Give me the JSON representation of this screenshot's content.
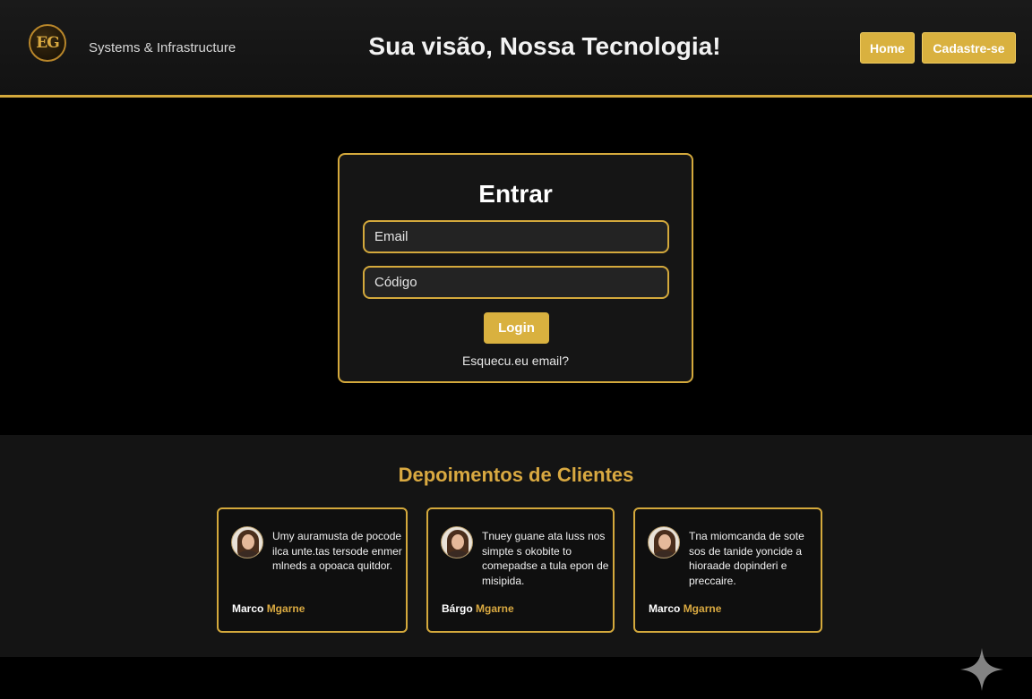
{
  "header": {
    "logo_text": "EG",
    "brand": "Systems & Infrastructure",
    "headline": "Sua visão, Nossa Tecnologia!",
    "nav": [
      {
        "label": "Home"
      },
      {
        "label": "Cadastre-se"
      }
    ]
  },
  "login": {
    "title": "Entrar",
    "email_placeholder": "Email",
    "code_placeholder": "Código",
    "button": "Login",
    "forgot": "Esquecu.eu email?"
  },
  "testimonials": {
    "title": "Depoimentos de Clientes",
    "cards": [
      {
        "text": "Umy auramusta de pocode ilca unte.tas tersode enmer mlneds a opoaca quitdor.",
        "first": "Marco",
        "last": "Mgarne"
      },
      {
        "text": "Tnuey guane ata luss nos simpte s okobite to comepadse a tula epon de misipida.",
        "first": "Bárgo",
        "last": "Mgarne"
      },
      {
        "text": "Tna miomcanda de sote sos de tanide yoncide a hioraade dopinderi e preccaire.",
        "first": "Marco",
        "last": "Mgarne"
      }
    ]
  },
  "colors": {
    "accent": "#d9b13f",
    "background": "#000000",
    "panel": "#151515"
  }
}
